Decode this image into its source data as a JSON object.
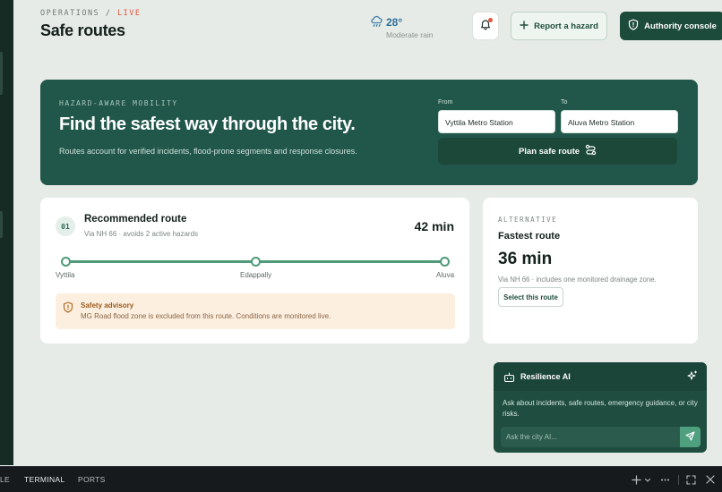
{
  "header": {
    "breadcrumb_section": "OPERATIONS",
    "breadcrumb_sep": "/",
    "breadcrumb_status": "LIVE",
    "title": "Safe routes",
    "weather": {
      "icon": "rain-cloud-icon",
      "temp": "28°",
      "condition": "Moderate rain"
    },
    "notifications": {
      "icon": "bell-icon",
      "has_unread": true
    },
    "report_label": "Report a hazard",
    "authority_label": "Authority console"
  },
  "hero": {
    "eyebrow": "HAZARD-AWARE MOBILITY",
    "headline": "Find the safest way through the city.",
    "subtext": "Routes account for verified incidents, flood-prone segments and response closures.",
    "from_label": "From",
    "from_value": "Vyttila Metro Station",
    "to_label": "To",
    "to_value": "Aluva Metro Station",
    "plan_label": "Plan safe route"
  },
  "recommended": {
    "number": "01",
    "title": "Recommended route",
    "subtitle": "Via NH 66 · avoids 2 active hazards",
    "duration": "42 min",
    "stops": [
      "Vyttila",
      "Edappally",
      "Aluva"
    ],
    "advisory_title": "Safety advisory",
    "advisory_text": "MG Road flood zone is excluded from this route. Conditions are monitored live."
  },
  "alternative": {
    "eyebrow": "ALTERNATIVE",
    "title": "Fastest route",
    "duration": "36 min",
    "description": "Via NH 66 · includes one monitored drainage zone.",
    "select_label": "Select this route"
  },
  "assistant": {
    "title": "Resilience AI",
    "description": "Ask about incidents, safe routes, emergency guidance, or city risks.",
    "placeholder": "Ask the city AI..."
  },
  "panel": {
    "tabs": [
      "LE",
      "TERMINAL",
      "PORTS"
    ],
    "active_tab": "TERMINAL"
  },
  "colors": {
    "brand_dark": "#1c4a3b",
    "hero_bg": "#21574a",
    "accent_green": "#4f9a78",
    "live_red": "#e0573b",
    "advisory_bg": "#fcefe0"
  }
}
